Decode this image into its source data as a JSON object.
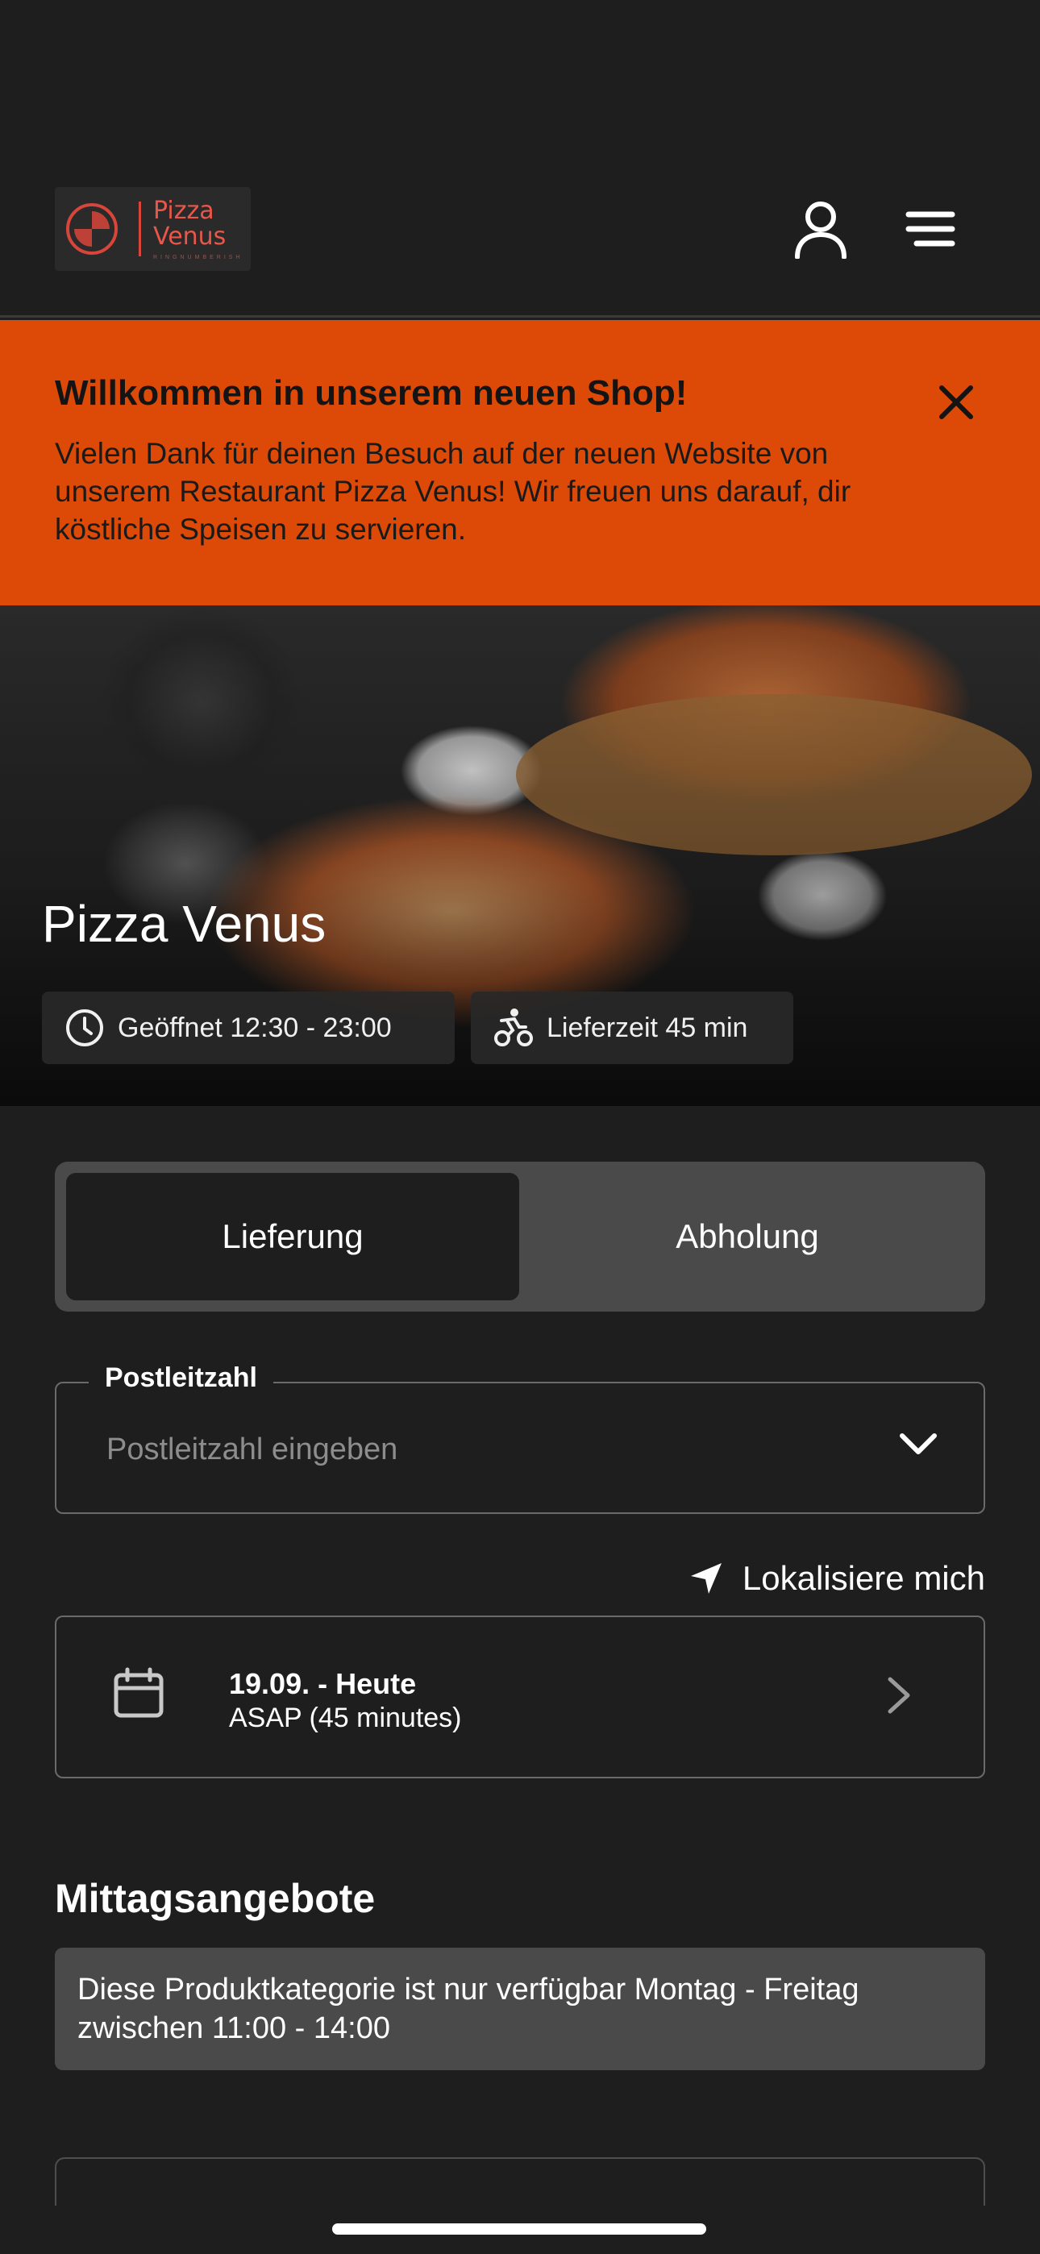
{
  "header": {
    "logo_text": "Pizza Venus",
    "logo_tagline": "RINGNUMBERISH",
    "account_icon": "user-icon",
    "menu_icon": "hamburger-menu-icon"
  },
  "banner": {
    "title": "Willkommen in unserem neuen Shop!",
    "text": "Vielen Dank für deinen Besuch auf der neuen Website von unserem Restaurant Pizza Venus! Wir freuen uns darauf, dir köstliche Speisen zu servieren.",
    "close_icon": "close-icon",
    "color": "#dd4a08"
  },
  "hero": {
    "title": "Pizza Venus",
    "opening": "Geöffnet 12:30 - 23:00",
    "delivery_time": "Lieferzeit 45 min"
  },
  "order_mode": {
    "delivery": "Lieferung",
    "pickup": "Abholung",
    "selected": "Lieferung"
  },
  "postcode": {
    "label": "Postleitzahl",
    "placeholder": "Postleitzahl eingeben",
    "value": ""
  },
  "locate": {
    "label": "Lokalisiere mich"
  },
  "schedule": {
    "date": "19.09. - Heute",
    "time": "ASAP (45 minutes)"
  },
  "lunch": {
    "title": "Mittagsangebote",
    "notice": "Diese Produktkategorie ist nur verfügbar Montag - Freitag zwischen 11:00 - 14:00"
  }
}
